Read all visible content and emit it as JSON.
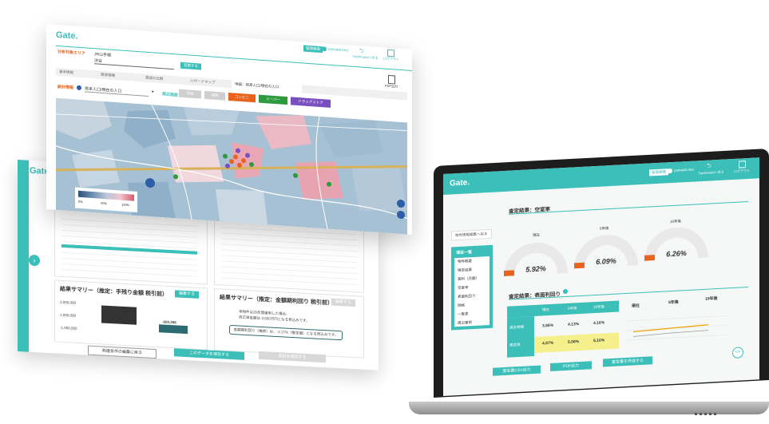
{
  "brand": {
    "logo": "Gate.",
    "accent": "#3bbfb8",
    "warning": "#e8641e",
    "highlight": "#f5f08c"
  },
  "back_card": {
    "logo": "Gate",
    "summary1_title": "結果サマリー（推定：手残り金額 税引前）",
    "summary1_button": "編集する",
    "summary1_values": [
      "3,000,000",
      "1,000,000",
      "-1,000,000"
    ],
    "summary1_bar_value": "-600,398",
    "summary2_title": "結果サマリー（推定：金額期利回り 税引前）",
    "summary2_button": "編集する",
    "summary2_text1": "本物件は20年間運用した場合、",
    "summary2_text2": "自己資金額は-3,600万円となる見込みです。",
    "summary2_box": "金額期利回り（推移）は、-3.17%（推定値）となる見込みです。",
    "bottom_btn1": "前提条件の編集に戻る",
    "bottom_btn2": "このデータを保存する",
    "bottom_btn3": "各段を保存する"
  },
  "top_card": {
    "logo": "Gate.",
    "area_label": "分析対象エリア",
    "area_value1": "JR山手線",
    "area_value2": "渋谷",
    "change_button": "変更する",
    "header_badge": "管理画面",
    "user_name": "yamada taro",
    "header_link1": "Dashboardへ戻る",
    "header_link2": "ログアウト",
    "pdf_label": "PDF出力",
    "tabs": [
      "基本情報",
      "賃貸相場",
      "賃貸の比較",
      "ハザードマップ",
      "地図：将来人口/現在の人口"
    ],
    "stat_label": "統計情報",
    "stat_select": "将来人口/現在の人口",
    "facility_label": "周辺施設",
    "chips": [
      {
        "label": "学校",
        "color": "#cfcfcf"
      },
      {
        "label": "病院",
        "color": "#cfcfcf"
      },
      {
        "label": "コンビニ",
        "color": "#e8641e"
      },
      {
        "label": "スーパー",
        "color": "#2e9a3e"
      },
      {
        "label": "ドラッグストア",
        "color": "#7a4fc0"
      }
    ],
    "legend": [
      "0%",
      "50%",
      "100%",
      "%"
    ]
  },
  "laptop": {
    "logo": "Gate.",
    "header_badge": "管理画面",
    "user_name": "yamada taro",
    "header_link1": "Dashboardへ戻る",
    "header_link2": "ログアウト",
    "back_link": "物件情報編集へ戻る",
    "sidebar_title": "項目一覧",
    "sidebar_items": [
      "物件概要",
      "推定結果",
      "賃料（月額）",
      "空室率",
      "表面利回り",
      "価格",
      "一覧表",
      "周辺事例"
    ],
    "section1_title": "査定結果：空室率",
    "gauge_labels": [
      "現在",
      "5年後",
      "10年後"
    ],
    "gauge_values": [
      "5.92%",
      "6.09%",
      "6.26%"
    ],
    "section2_title": "査定結果：表面利回り",
    "table_headers": [
      "",
      "現在",
      "5年後",
      "10年後"
    ],
    "table_rows": [
      {
        "label": "過去相場",
        "values": [
          "3.86%",
          "4.13%",
          "4.16%"
        ]
      },
      {
        "label": "推定値",
        "values": [
          "4.87%",
          "5.08%",
          "5.10%"
        ]
      }
    ],
    "chart_headers": [
      "現在",
      "5年後",
      "10年後"
    ],
    "buttons": [
      "査定書CSV出力",
      "PDF出力",
      "査定書を作成する"
    ],
    "top_button": "TOP"
  }
}
